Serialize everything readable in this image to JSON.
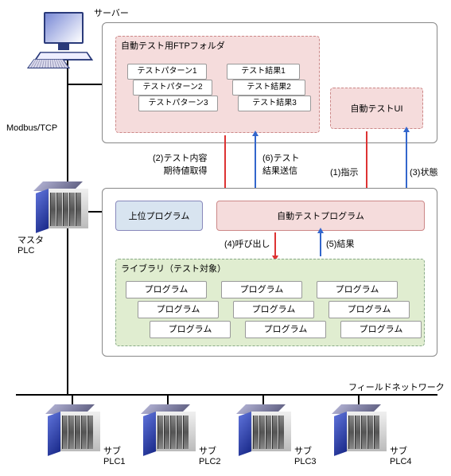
{
  "labels": {
    "server": "サーバー",
    "modbus": "Modbus/TCP",
    "master_plc": "マスタ\nPLC",
    "field_net": "フィールドネットワーク",
    "sub_plc": [
      "サブ\nPLC1",
      "サブ\nPLC2",
      "サブ\nPLC3",
      "サブ\nPLC4"
    ]
  },
  "server_box": {
    "ftp_folder": {
      "title": "自動テスト用FTPフォルダ",
      "patterns": [
        "テストパターン1",
        "テストパターン2",
        "テストパターン3"
      ],
      "results": [
        "テスト結果1",
        "テスト結果2",
        "テスト結果3"
      ]
    },
    "ui": "自動テストUI"
  },
  "plc_box": {
    "upper_prog": "上位プログラム",
    "auto_test_prog": "自動テストプログラム",
    "library": {
      "title": "ライブラリ（テスト対象）",
      "item": "プログラム"
    }
  },
  "arrows": {
    "a1": "(1)指示",
    "a2": "(2)テスト内容\n期待値取得",
    "a3": "(3)状態",
    "a4": "(4)呼び出し",
    "a5": "(5)結果",
    "a6": "(6)テスト\n結果送信"
  }
}
